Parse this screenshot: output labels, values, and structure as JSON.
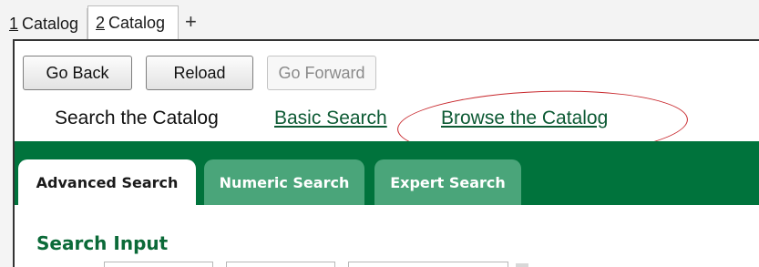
{
  "tabs": [
    {
      "num": "1",
      "label": "Catalog"
    },
    {
      "num": "2",
      "label": "Catalog"
    }
  ],
  "new_tab_label": "+",
  "nav": {
    "back": "Go Back",
    "reload": "Reload",
    "forward": "Go Forward"
  },
  "catalog_nav": {
    "title": "Search the Catalog",
    "basic_search": "Basic Search",
    "browse": "Browse the Catalog"
  },
  "search_tabs": {
    "advanced": "Advanced Search",
    "numeric": "Numeric Search",
    "expert": "Expert Search"
  },
  "section": {
    "title": "Search Input"
  },
  "colors": {
    "brand_green": "#00733c",
    "tab_inactive": "#4aa57a",
    "annotation_red": "#c8282d"
  }
}
